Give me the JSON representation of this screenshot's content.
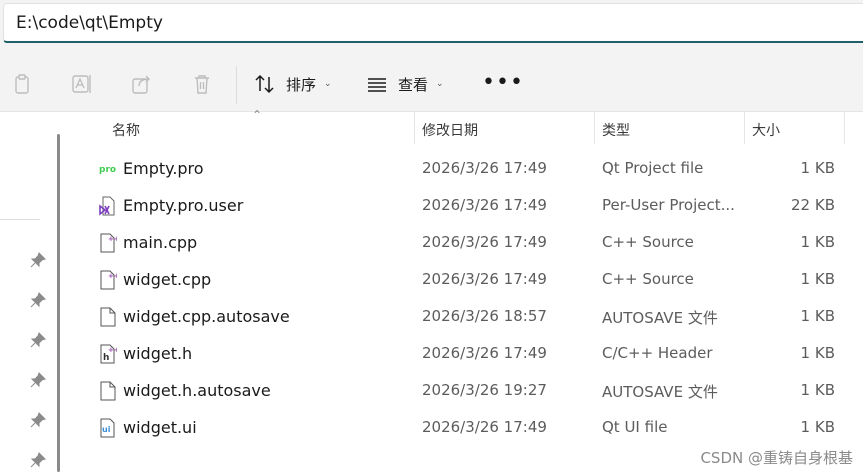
{
  "address_bar": {
    "path": "E:\\code\\qt\\Empty"
  },
  "toolbar": {
    "copy_icon": "copy-icon",
    "rename_icon": "rename-icon",
    "share_icon": "share-icon",
    "delete_icon": "trash-icon",
    "sort_label": "排序",
    "view_label": "查看",
    "more_label": "•••"
  },
  "columns": {
    "name": "名称",
    "modified": "修改日期",
    "type": "类型",
    "size": "大小"
  },
  "files": [
    {
      "name": "Empty.pro",
      "modified": "2026/3/26 17:49",
      "type": "Qt Project file",
      "size": "1 KB",
      "icon": "pro-file-icon"
    },
    {
      "name": "Empty.pro.user",
      "modified": "2026/3/26 17:49",
      "type": "Per-User Project...",
      "size": "22 KB",
      "icon": "vs-user-file-icon"
    },
    {
      "name": "main.cpp",
      "modified": "2026/3/26 17:49",
      "type": "C++ Source",
      "size": "1 KB",
      "icon": "cpp-file-icon"
    },
    {
      "name": "widget.cpp",
      "modified": "2026/3/26 17:49",
      "type": "C++ Source",
      "size": "1 KB",
      "icon": "cpp-file-icon"
    },
    {
      "name": "widget.cpp.autosave",
      "modified": "2026/3/26 18:57",
      "type": "AUTOSAVE 文件",
      "size": "1 KB",
      "icon": "blank-file-icon"
    },
    {
      "name": "widget.h",
      "modified": "2026/3/26 17:49",
      "type": "C/C++ Header",
      "size": "1 KB",
      "icon": "header-file-icon"
    },
    {
      "name": "widget.h.autosave",
      "modified": "2026/3/26 19:27",
      "type": "AUTOSAVE 文件",
      "size": "1 KB",
      "icon": "blank-file-icon"
    },
    {
      "name": "widget.ui",
      "modified": "2026/3/26 17:49",
      "type": "Qt UI file",
      "size": "1 KB",
      "icon": "ui-file-icon"
    }
  ],
  "watermark": "CSDN @重铸自身根基"
}
